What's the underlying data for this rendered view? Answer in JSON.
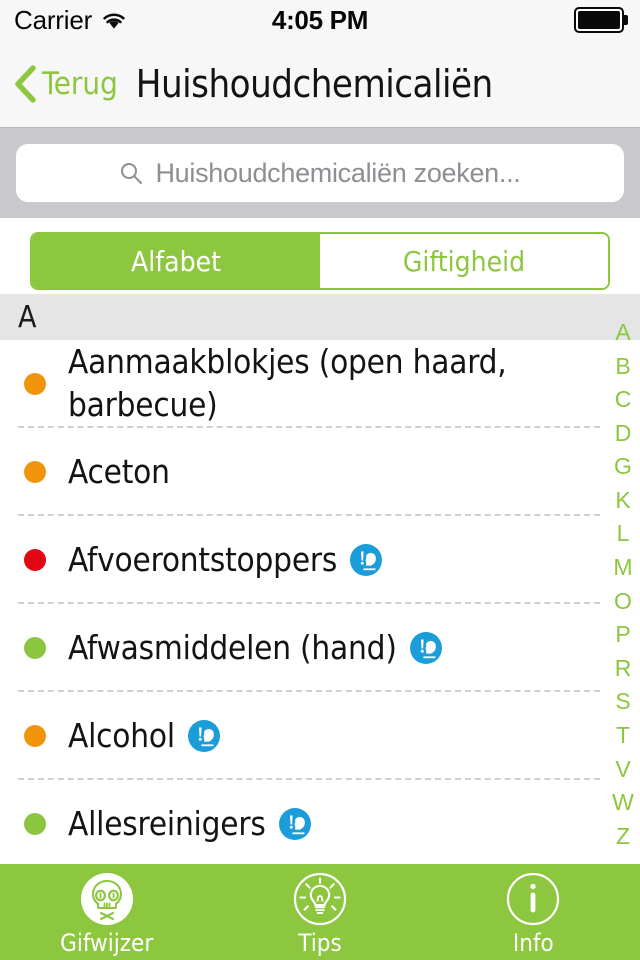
{
  "status_bar": {
    "carrier": "Carrier",
    "time": "4:05 PM",
    "wifi_icon": "wifi-icon",
    "battery_icon": "battery-full-icon"
  },
  "nav": {
    "back_label": "Terug",
    "back_icon": "chevron-left-icon",
    "title": "Huishoudchemicaliën"
  },
  "search": {
    "icon": "search-icon",
    "placeholder": "Huishoudchemicaliën zoeken...",
    "value": ""
  },
  "segmented": {
    "selected_index": 0,
    "options": [
      {
        "label": "Alfabet",
        "selected": true
      },
      {
        "label": "Giftigheid",
        "selected": false
      }
    ]
  },
  "colors": {
    "brand_green": "#8dc63f",
    "toxicity_low": "#8cc63e",
    "toxicity_medium": "#f2940b",
    "toxicity_high": "#e30613",
    "navbar_bg": "#f7f7f7",
    "search_bg": "#c8c8cd",
    "section_bg": "#e5e5e5",
    "icon_blue": "#1a9dd9"
  },
  "list": {
    "section_title": "A",
    "rows": [
      {
        "label": "Aanmaakblokjes (open haard, barbecue)",
        "dot_color": "#f2940b",
        "dot_level": "medium",
        "tag_icon": null
      },
      {
        "label": "Aceton",
        "dot_color": "#f2940b",
        "dot_level": "medium",
        "tag_icon": null
      },
      {
        "label": "Afvoerontstoppers",
        "dot_color": "#e30613",
        "dot_level": "high",
        "tag_icon": "wear-gloves-icon"
      },
      {
        "label": "Afwasmiddelen (hand)",
        "dot_color": "#8cc63e",
        "dot_level": "low",
        "tag_icon": "wear-gloves-icon"
      },
      {
        "label": "Alcohol",
        "dot_color": "#f2940b",
        "dot_level": "medium",
        "tag_icon": "wear-gloves-icon"
      },
      {
        "label": "Allesreinigers",
        "dot_color": "#8cc63e",
        "dot_level": "low",
        "tag_icon": "wear-gloves-icon"
      }
    ]
  },
  "index_bar": {
    "letters": [
      "A",
      "B",
      "C",
      "D",
      "G",
      "K",
      "L",
      "M",
      "O",
      "P",
      "R",
      "S",
      "T",
      "V",
      "W",
      "Z"
    ]
  },
  "tab_bar": {
    "tabs": [
      {
        "label": "Gifwijzer",
        "icon": "skull-face-icon",
        "active": true
      },
      {
        "label": "Tips",
        "icon": "lightbulb-icon",
        "active": false
      },
      {
        "label": "Info",
        "icon": "info-circle-icon",
        "active": false
      }
    ]
  }
}
